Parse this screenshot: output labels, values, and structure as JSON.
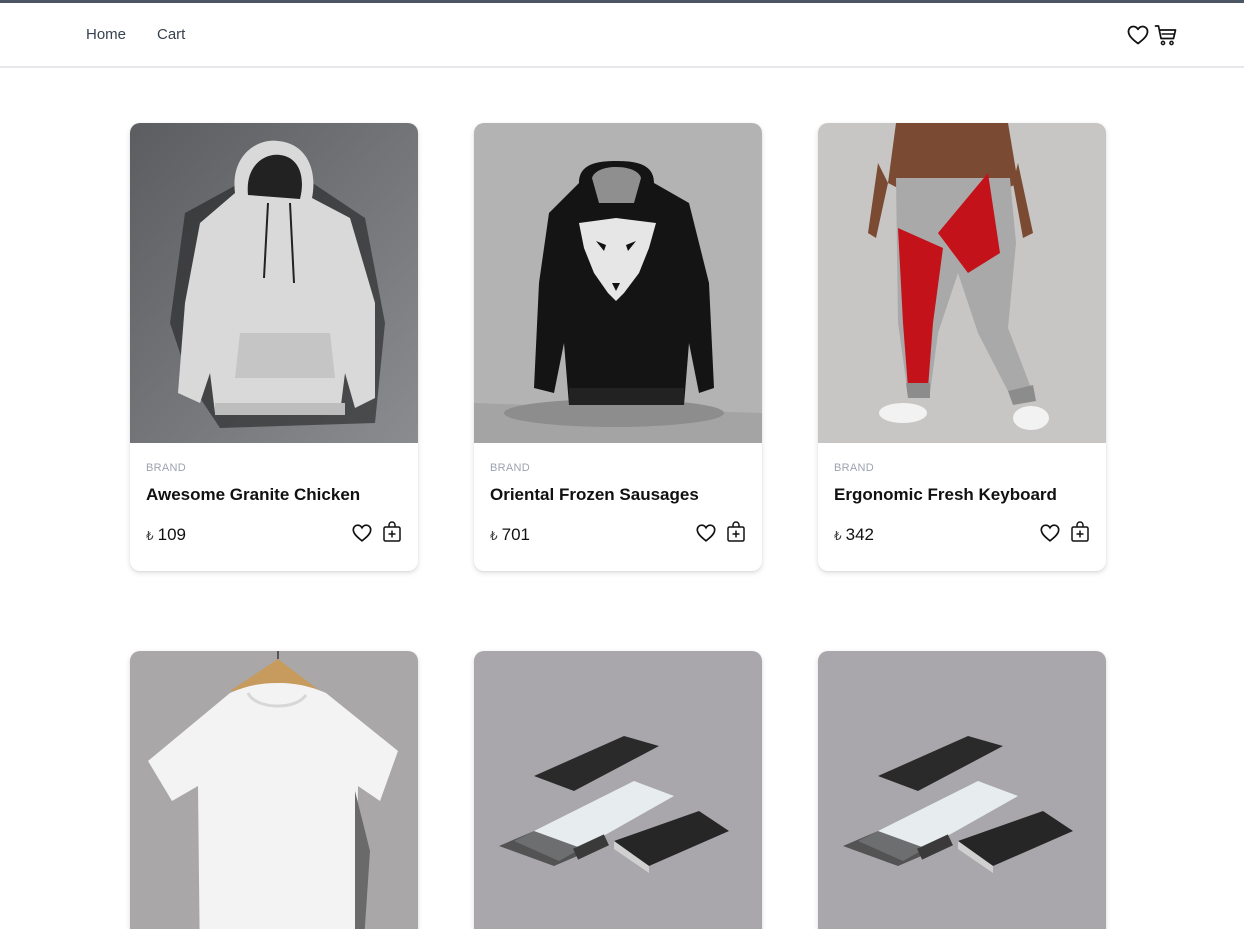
{
  "nav": {
    "links": [
      {
        "label": "Home"
      },
      {
        "label": "Cart"
      }
    ],
    "icons": [
      "heart-icon",
      "cart-icon"
    ]
  },
  "products": [
    {
      "brand": "BRAND",
      "title": "Awesome Granite Chicken",
      "currency": "₺",
      "price": "109",
      "image": "grey-hoodie"
    },
    {
      "brand": "BRAND",
      "title": "Oriental Frozen Sausages",
      "currency": "₺",
      "price": "701",
      "image": "black-wolf-hoodie"
    },
    {
      "brand": "BRAND",
      "title": "Ergonomic Fresh Keyboard",
      "currency": "₺",
      "price": "342",
      "image": "red-grey-joggers"
    },
    {
      "image": "white-tshirt"
    },
    {
      "image": "phone-and-case"
    },
    {
      "image": "phone-and-case"
    }
  ],
  "colors": {
    "accent_bar": "#4b5563",
    "text": "#111111",
    "muted": "#9ca3af"
  }
}
